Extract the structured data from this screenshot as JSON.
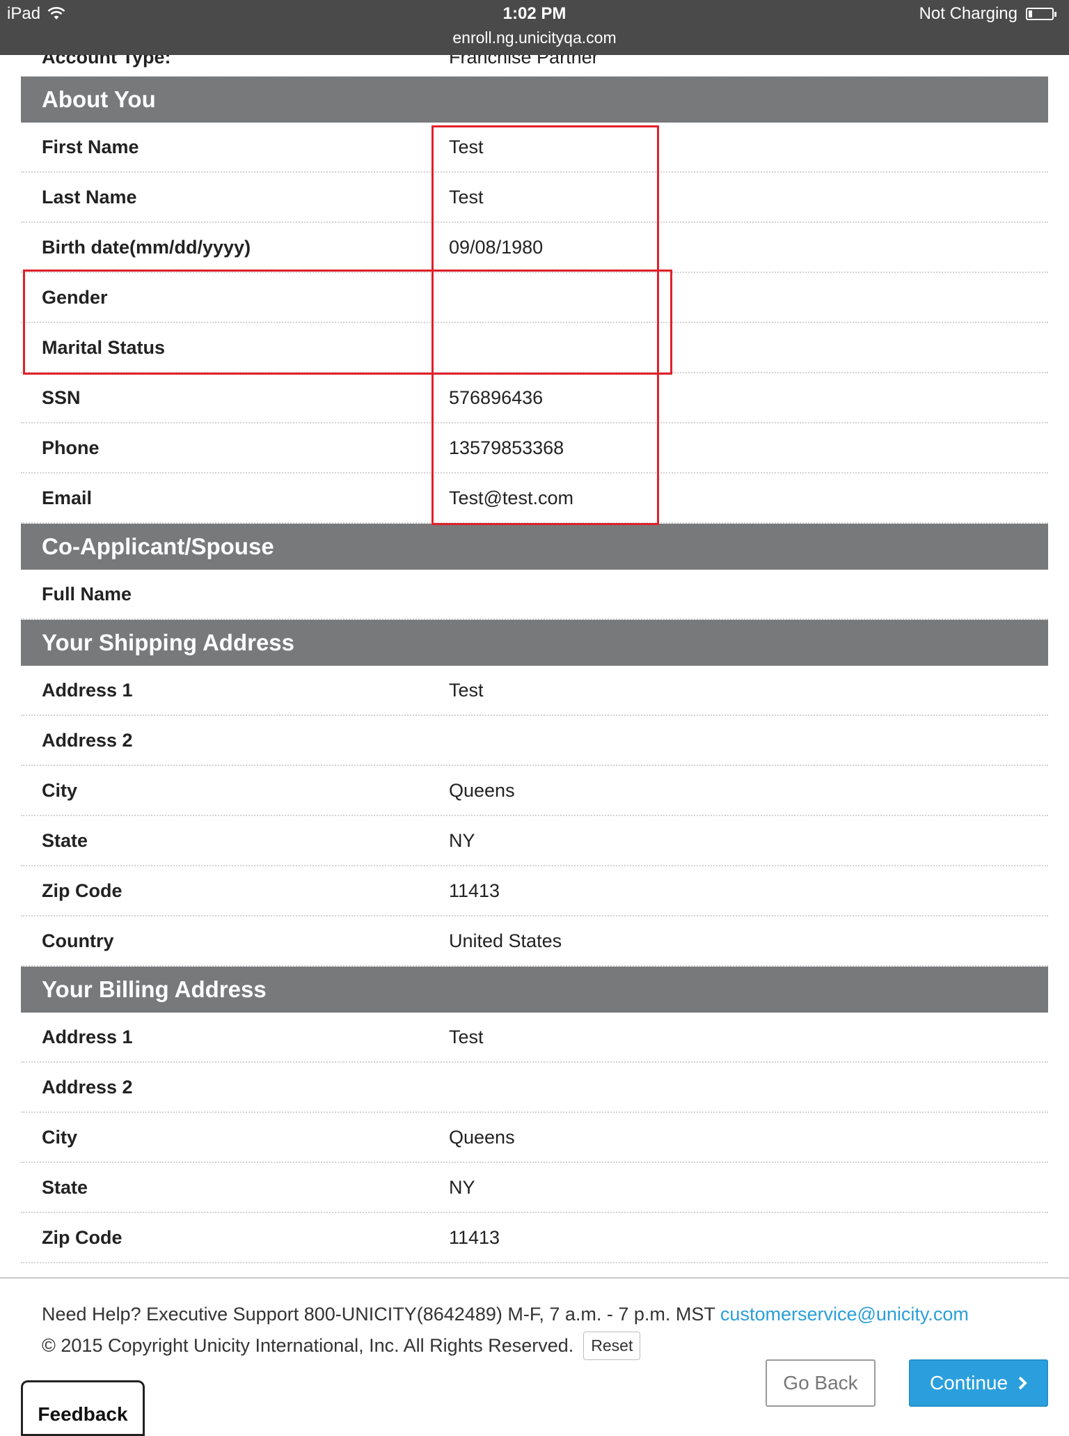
{
  "statusbar": {
    "device": "iPad",
    "time": "1:02 PM",
    "url": "enroll.ng.unicityqa.com",
    "battery_text": "Not Charging"
  },
  "cut_row": {
    "label": "Account Type:",
    "value": "Franchise Partner"
  },
  "about": {
    "title": "About You",
    "rows": [
      {
        "label": "First Name",
        "value": "Test"
      },
      {
        "label": "Last Name",
        "value": "Test"
      },
      {
        "label": "Birth date(mm/dd/yyyy)",
        "value": "09/08/1980"
      },
      {
        "label": "Gender",
        "value": ""
      },
      {
        "label": "Marital Status",
        "value": ""
      },
      {
        "label": "SSN",
        "value": "576896436"
      },
      {
        "label": "Phone",
        "value": "13579853368"
      },
      {
        "label": "Email",
        "value": "Test@test.com"
      }
    ]
  },
  "coapplicant": {
    "title": "Co-Applicant/Spouse",
    "rows": [
      {
        "label": "Full Name",
        "value": ""
      }
    ]
  },
  "shipping": {
    "title": "Your Shipping Address",
    "rows": [
      {
        "label": "Address 1",
        "value": "Test"
      },
      {
        "label": "Address 2",
        "value": ""
      },
      {
        "label": "City",
        "value": "Queens"
      },
      {
        "label": "State",
        "value": "NY"
      },
      {
        "label": "Zip Code",
        "value": "11413"
      },
      {
        "label": "Country",
        "value": "United States"
      }
    ]
  },
  "billing": {
    "title": "Your Billing Address",
    "rows": [
      {
        "label": "Address 1",
        "value": "Test"
      },
      {
        "label": "Address 2",
        "value": ""
      },
      {
        "label": "City",
        "value": "Queens"
      },
      {
        "label": "State",
        "value": "NY"
      },
      {
        "label": "Zip Code",
        "value": "11413"
      }
    ]
  },
  "footer": {
    "help_text": "Need Help? Executive Support 800-UNICITY(8642489) M-F, 7 a.m. - 7 p.m. MST",
    "help_email": "customerservice@unicity.com",
    "copyright": "© 2015 Copyright Unicity International, Inc. All Rights Reserved.",
    "reset_label": "Reset",
    "go_back_label": "Go Back",
    "continue_label": "Continue",
    "feedback_label": "Feedback"
  },
  "colors": {
    "section_header": "#77797b",
    "annotation_red": "#e0202a",
    "link": "#2a9fd6",
    "continue_button": "#2b9fdd"
  }
}
